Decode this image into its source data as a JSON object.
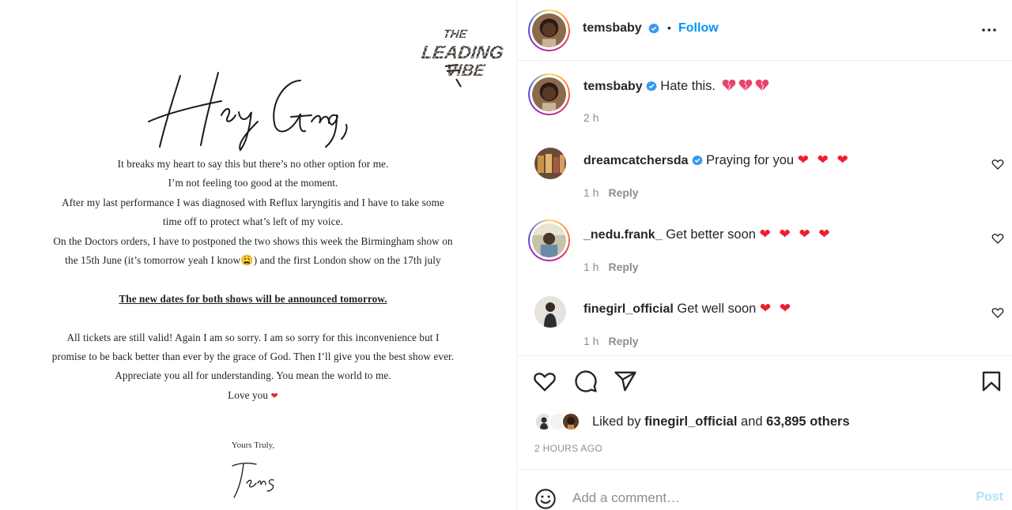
{
  "post_image": {
    "logo_text": "THE LEADING VIBE",
    "greeting": "Hey Gang,",
    "letter": {
      "line1": "It breaks my heart to say this but there’s no other option for me.",
      "line2": "I’m not feeling too good at the moment.",
      "line3": "After my last performance I was diagnosed with Reflux laryngitis and I have to take some",
      "line4": "time off to protect what’s left of my voice.",
      "line5": "On the Doctors orders, I have to postponed the two shows this week the Birmingham show on",
      "line6": "the 15th June (it’s tomorrow yeah I know😩) and the first London show on the 17th july",
      "line7": "The new dates for both shows will be announced tomorrow.",
      "line8": "All tickets are still valid! Again I am so sorry. I am so sorry for this inconvenience but I",
      "line9": "promise to be back better than ever by the grace of God. Then I’ll give you the best show ever.",
      "line10": "Appreciate you all for understanding. You mean the world to me.",
      "line11": "Love you",
      "heart": "❤"
    },
    "closing": "Yours Truly,",
    "signature": "Tems"
  },
  "header": {
    "username": "temsbaby",
    "separator": "•",
    "follow_label": "Follow",
    "more_icon": "more-options-icon"
  },
  "caption": {
    "username": "temsbaby",
    "text": "Hate this.",
    "time": "2 h"
  },
  "comments": [
    {
      "username": "dreamcatchersda",
      "verified": true,
      "text": "Praying for you",
      "hearts": "❤ ❤ ❤",
      "time": "1 h",
      "reply": "Reply"
    },
    {
      "username": "_nedu.frank_",
      "verified": false,
      "text": "Get better soon",
      "hearts": "❤ ❤ ❤ ❤",
      "time": "1 h",
      "reply": "Reply"
    },
    {
      "username": "finegirl_official",
      "verified": false,
      "text": "Get well soon",
      "hearts": "❤ ❤",
      "time": "1 h",
      "reply": "Reply"
    }
  ],
  "actions": {
    "like_icon": "heart-outline-icon",
    "comment_icon": "comment-bubble-icon",
    "share_icon": "paper-plane-icon",
    "save_icon": "bookmark-icon"
  },
  "likes": {
    "prefix": "Liked by",
    "user": "finegirl_official",
    "and": "and",
    "count_text": "63,895 others"
  },
  "time_ago": "2 HOURS AGO",
  "add_comment": {
    "emoji_icon": "emoji-smiley-icon",
    "placeholder": "Add a comment…",
    "post_label": "Post"
  },
  "colors": {
    "link_blue": "#0095f6",
    "verified_blue": "#3897f0",
    "heart_red": "#ed1f2c",
    "post_disabled": "#b2dffc"
  }
}
